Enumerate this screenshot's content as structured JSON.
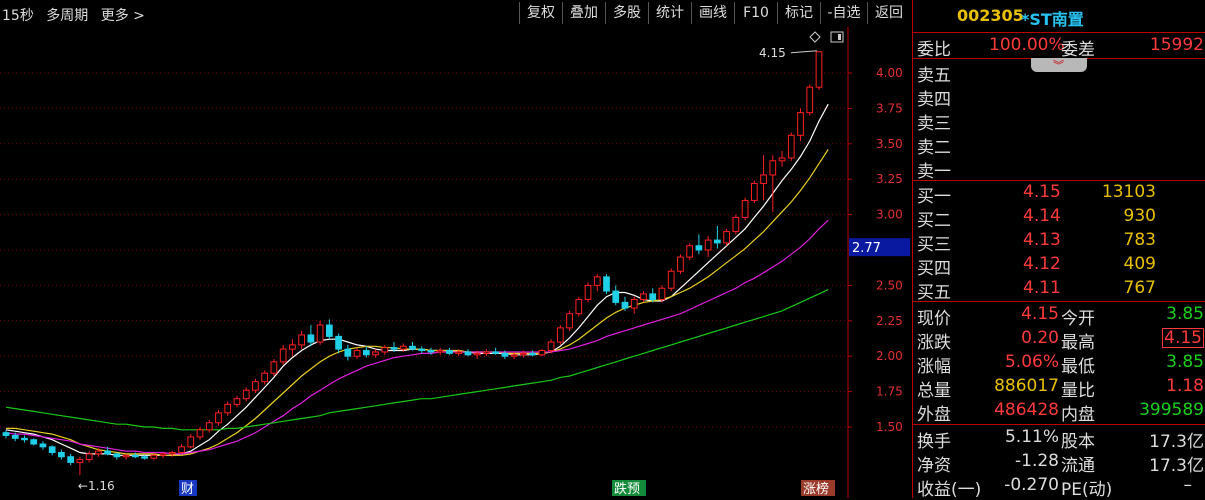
{
  "toolbar": {
    "left_items": [
      "15秒",
      "多周期",
      "更多 >"
    ],
    "buttons": [
      "复权",
      "叠加",
      "多股",
      "统计",
      "画线",
      "F10",
      "标记",
      "-自选",
      "返回"
    ]
  },
  "chart_data": {
    "type": "candlestick",
    "y_ticks": [
      "4.00",
      "3.75",
      "3.50",
      "3.25",
      "3.00",
      "2.75",
      "2.50",
      "2.25",
      "2.00",
      "1.75",
      "1.50"
    ],
    "ylim": [
      1.25,
      4.25
    ],
    "current_price_label": "2.77",
    "high_annotation": "4.15",
    "low_annotation": "←1.16",
    "bottom_markers": [
      "财",
      "跌预",
      "涨榜"
    ],
    "candles": [
      [
        1.46,
        1.48,
        1.42,
        1.44
      ],
      [
        1.44,
        1.46,
        1.4,
        1.42
      ],
      [
        1.42,
        1.44,
        1.39,
        1.41
      ],
      [
        1.41,
        1.42,
        1.37,
        1.38
      ],
      [
        1.38,
        1.4,
        1.34,
        1.36
      ],
      [
        1.36,
        1.37,
        1.3,
        1.32
      ],
      [
        1.32,
        1.34,
        1.27,
        1.29
      ],
      [
        1.29,
        1.31,
        1.23,
        1.25
      ],
      [
        1.25,
        1.29,
        1.16,
        1.27
      ],
      [
        1.27,
        1.33,
        1.25,
        1.31
      ],
      [
        1.31,
        1.35,
        1.29,
        1.33
      ],
      [
        1.33,
        1.36,
        1.3,
        1.31
      ],
      [
        1.31,
        1.32,
        1.27,
        1.29
      ],
      [
        1.29,
        1.31,
        1.27,
        1.3
      ],
      [
        1.3,
        1.32,
        1.28,
        1.29
      ],
      [
        1.29,
        1.3,
        1.27,
        1.28
      ],
      [
        1.28,
        1.31,
        1.27,
        1.3
      ],
      [
        1.3,
        1.32,
        1.28,
        1.31
      ],
      [
        1.31,
        1.33,
        1.29,
        1.32
      ],
      [
        1.32,
        1.38,
        1.31,
        1.36
      ],
      [
        1.36,
        1.45,
        1.35,
        1.43
      ],
      [
        1.43,
        1.5,
        1.41,
        1.48
      ],
      [
        1.48,
        1.55,
        1.46,
        1.53
      ],
      [
        1.53,
        1.62,
        1.51,
        1.6
      ],
      [
        1.6,
        1.68,
        1.58,
        1.66
      ],
      [
        1.66,
        1.72,
        1.64,
        1.7
      ],
      [
        1.7,
        1.78,
        1.68,
        1.76
      ],
      [
        1.76,
        1.84,
        1.74,
        1.82
      ],
      [
        1.82,
        1.9,
        1.8,
        1.88
      ],
      [
        1.88,
        1.98,
        1.86,
        1.96
      ],
      [
        1.96,
        2.08,
        1.94,
        2.05
      ],
      [
        2.05,
        2.12,
        2.0,
        2.08
      ],
      [
        2.08,
        2.18,
        2.05,
        2.15
      ],
      [
        2.15,
        2.22,
        2.07,
        2.1
      ],
      [
        2.1,
        2.25,
        2.08,
        2.22
      ],
      [
        2.22,
        2.26,
        2.12,
        2.14
      ],
      [
        2.14,
        2.16,
        2.02,
        2.05
      ],
      [
        2.05,
        2.08,
        1.97,
        2.0
      ],
      [
        2.0,
        2.06,
        1.98,
        2.04
      ],
      [
        2.04,
        2.07,
        1.99,
        2.01
      ],
      [
        2.01,
        2.05,
        1.99,
        2.03
      ],
      [
        2.03,
        2.08,
        2.01,
        2.06
      ],
      [
        2.06,
        2.1,
        2.03,
        2.05
      ],
      [
        2.05,
        2.09,
        2.03,
        2.07
      ],
      [
        2.07,
        2.1,
        2.04,
        2.05
      ],
      [
        2.05,
        2.07,
        2.02,
        2.04
      ],
      [
        2.04,
        2.06,
        2.01,
        2.03
      ],
      [
        2.03,
        2.06,
        2.01,
        2.04
      ],
      [
        2.04,
        2.06,
        2.01,
        2.02
      ],
      [
        2.02,
        2.05,
        2.0,
        2.03
      ],
      [
        2.03,
        2.05,
        2.0,
        2.01
      ],
      [
        2.01,
        2.04,
        1.98,
        2.02
      ],
      [
        2.02,
        2.05,
        2.0,
        2.03
      ],
      [
        2.03,
        2.06,
        2.01,
        2.02
      ],
      [
        2.02,
        2.04,
        1.98,
        2.0
      ],
      [
        2.0,
        2.03,
        1.98,
        2.01
      ],
      [
        2.01,
        2.04,
        1.99,
        2.02
      ],
      [
        2.02,
        2.04,
        2.0,
        2.01
      ],
      [
        2.01,
        2.05,
        2.0,
        2.04
      ],
      [
        2.04,
        2.12,
        2.02,
        2.1
      ],
      [
        2.1,
        2.22,
        2.08,
        2.2
      ],
      [
        2.2,
        2.32,
        2.18,
        2.3
      ],
      [
        2.3,
        2.42,
        2.28,
        2.4
      ],
      [
        2.4,
        2.52,
        2.38,
        2.5
      ],
      [
        2.5,
        2.58,
        2.46,
        2.56
      ],
      [
        2.56,
        2.58,
        2.44,
        2.46
      ],
      [
        2.46,
        2.5,
        2.36,
        2.38
      ],
      [
        2.38,
        2.42,
        2.32,
        2.34
      ],
      [
        2.34,
        2.42,
        2.3,
        2.4
      ],
      [
        2.4,
        2.46,
        2.38,
        2.44
      ],
      [
        2.44,
        2.48,
        2.38,
        2.4
      ],
      [
        2.4,
        2.5,
        2.38,
        2.48
      ],
      [
        2.48,
        2.62,
        2.46,
        2.6
      ],
      [
        2.6,
        2.72,
        2.58,
        2.7
      ],
      [
        2.7,
        2.8,
        2.68,
        2.78
      ],
      [
        2.78,
        2.86,
        2.72,
        2.75
      ],
      [
        2.75,
        2.85,
        2.7,
        2.82
      ],
      [
        2.82,
        2.92,
        2.76,
        2.8
      ],
      [
        2.8,
        2.9,
        2.78,
        2.88
      ],
      [
        2.88,
        3.0,
        2.86,
        2.98
      ],
      [
        2.98,
        3.12,
        2.96,
        3.1
      ],
      [
        3.1,
        3.24,
        3.08,
        3.22
      ],
      [
        3.22,
        3.42,
        3.1,
        3.28
      ],
      [
        3.28,
        3.42,
        3.02,
        3.38
      ],
      [
        3.38,
        3.45,
        3.34,
        3.4
      ],
      [
        3.4,
        3.58,
        3.38,
        3.56
      ],
      [
        3.56,
        3.75,
        3.52,
        3.72
      ],
      [
        3.72,
        3.92,
        3.7,
        3.9
      ],
      [
        3.9,
        4.15,
        3.88,
        4.15
      ]
    ],
    "ma_series": [
      {
        "color": "#ffffff",
        "values": [
          1.48,
          1.47,
          1.46,
          1.45,
          1.43,
          1.41,
          1.38,
          1.35,
          1.32,
          1.31,
          1.31,
          1.31,
          1.3,
          1.3,
          1.3,
          1.3,
          1.3,
          1.3,
          1.3,
          1.31,
          1.33,
          1.37,
          1.41,
          1.47,
          1.52,
          1.58,
          1.64,
          1.71,
          1.78,
          1.85,
          1.93,
          1.99,
          2.04,
          2.08,
          2.11,
          2.12,
          2.12,
          2.1,
          2.08,
          2.07,
          2.05,
          2.04,
          2.04,
          2.04,
          2.05,
          2.05,
          2.04,
          2.04,
          2.04,
          2.03,
          2.03,
          2.02,
          2.02,
          2.02,
          2.02,
          2.01,
          2.01,
          2.01,
          2.02,
          2.03,
          2.07,
          2.13,
          2.2,
          2.28,
          2.36,
          2.42,
          2.45,
          2.45,
          2.43,
          2.4,
          2.39,
          2.39,
          2.42,
          2.48,
          2.54,
          2.6,
          2.66,
          2.72,
          2.78,
          2.84,
          2.9,
          2.98,
          3.06,
          3.15,
          3.24,
          3.32,
          3.41,
          3.52,
          3.66,
          3.78
        ]
      },
      {
        "color": "#e8d020",
        "values": [
          1.49,
          1.49,
          1.48,
          1.47,
          1.46,
          1.45,
          1.43,
          1.41,
          1.38,
          1.36,
          1.34,
          1.33,
          1.32,
          1.31,
          1.31,
          1.31,
          1.31,
          1.3,
          1.3,
          1.3,
          1.31,
          1.33,
          1.35,
          1.38,
          1.42,
          1.46,
          1.51,
          1.56,
          1.62,
          1.68,
          1.74,
          1.8,
          1.86,
          1.91,
          1.96,
          2.0,
          2.03,
          2.05,
          2.06,
          2.07,
          2.07,
          2.06,
          2.06,
          2.05,
          2.05,
          2.05,
          2.04,
          2.04,
          2.04,
          2.04,
          2.03,
          2.03,
          2.03,
          2.03,
          2.02,
          2.02,
          2.02,
          2.02,
          2.02,
          2.03,
          2.05,
          2.08,
          2.12,
          2.17,
          2.22,
          2.27,
          2.31,
          2.34,
          2.36,
          2.38,
          2.39,
          2.4,
          2.42,
          2.45,
          2.48,
          2.52,
          2.56,
          2.61,
          2.66,
          2.71,
          2.76,
          2.82,
          2.88,
          2.95,
          3.02,
          3.09,
          3.17,
          3.26,
          3.36,
          3.46
        ]
      },
      {
        "color": "#e020e0",
        "values": [
          1.46,
          1.45,
          1.45,
          1.44,
          1.43,
          1.42,
          1.41,
          1.4,
          1.38,
          1.37,
          1.36,
          1.35,
          1.34,
          1.33,
          1.33,
          1.32,
          1.32,
          1.32,
          1.31,
          1.31,
          1.32,
          1.33,
          1.34,
          1.36,
          1.38,
          1.4,
          1.43,
          1.46,
          1.5,
          1.54,
          1.58,
          1.63,
          1.67,
          1.72,
          1.76,
          1.8,
          1.84,
          1.87,
          1.9,
          1.93,
          1.95,
          1.97,
          1.99,
          2.0,
          2.01,
          2.02,
          2.02,
          2.03,
          2.03,
          2.03,
          2.03,
          2.03,
          2.03,
          2.03,
          2.03,
          2.03,
          2.03,
          2.03,
          2.03,
          2.03,
          2.04,
          2.05,
          2.07,
          2.09,
          2.11,
          2.14,
          2.16,
          2.18,
          2.2,
          2.22,
          2.24,
          2.26,
          2.28,
          2.3,
          2.33,
          2.36,
          2.39,
          2.42,
          2.45,
          2.48,
          2.52,
          2.55,
          2.59,
          2.63,
          2.67,
          2.72,
          2.77,
          2.83,
          2.9,
          2.96
        ]
      },
      {
        "color": "#18c818",
        "values": [
          1.64,
          1.63,
          1.62,
          1.61,
          1.6,
          1.59,
          1.58,
          1.57,
          1.56,
          1.55,
          1.54,
          1.53,
          1.52,
          1.52,
          1.51,
          1.5,
          1.5,
          1.49,
          1.49,
          1.48,
          1.48,
          1.48,
          1.48,
          1.48,
          1.49,
          1.49,
          1.5,
          1.51,
          1.52,
          1.53,
          1.54,
          1.55,
          1.56,
          1.57,
          1.58,
          1.6,
          1.61,
          1.62,
          1.63,
          1.64,
          1.65,
          1.66,
          1.67,
          1.68,
          1.69,
          1.7,
          1.7,
          1.71,
          1.72,
          1.73,
          1.74,
          1.75,
          1.76,
          1.77,
          1.78,
          1.79,
          1.8,
          1.81,
          1.82,
          1.83,
          1.85,
          1.86,
          1.88,
          1.9,
          1.92,
          1.94,
          1.96,
          1.98,
          2.0,
          2.02,
          2.04,
          2.06,
          2.08,
          2.1,
          2.12,
          2.14,
          2.16,
          2.18,
          2.2,
          2.22,
          2.24,
          2.26,
          2.28,
          2.3,
          2.32,
          2.35,
          2.38,
          2.41,
          2.44,
          2.47
        ]
      }
    ]
  },
  "panel": {
    "code": "002305",
    "name": "*ST南置",
    "webi": {
      "label": "委比",
      "value": "100.00%",
      "label2": "委差",
      "value2": "15992"
    },
    "sells": [
      {
        "label": "卖五"
      },
      {
        "label": "卖四"
      },
      {
        "label": "卖三"
      },
      {
        "label": "卖二"
      },
      {
        "label": "卖一"
      }
    ],
    "buys": [
      {
        "label": "买一",
        "price": "4.15",
        "vol": "13103"
      },
      {
        "label": "买二",
        "price": "4.14",
        "vol": "930"
      },
      {
        "label": "买三",
        "price": "4.13",
        "vol": "783"
      },
      {
        "label": "买四",
        "price": "4.12",
        "vol": "409"
      },
      {
        "label": "买五",
        "price": "4.11",
        "vol": "767"
      }
    ],
    "stats": [
      {
        "l1": "现价",
        "v1": "4.15",
        "l2": "今开",
        "v2": "3.85"
      },
      {
        "l1": "涨跌",
        "v1": "0.20",
        "l2": "最高",
        "v2": "4.15"
      },
      {
        "l1": "涨幅",
        "v1": "5.06%",
        "l2": "最低",
        "v2": "3.85"
      },
      {
        "l1": "总量",
        "v1": "886017",
        "l2": "量比",
        "v2": "1.18"
      },
      {
        "l1": "外盘",
        "v1": "486428",
        "l2": "内盘",
        "v2": "399589"
      }
    ],
    "fin": [
      {
        "l1": "换手",
        "v1": "5.11%",
        "l2": "股本",
        "v2": "17.3亿"
      },
      {
        "l1": "净资",
        "v1": "-1.28",
        "l2": "流通",
        "v2": "17.3亿"
      },
      {
        "l1": "收益(一)",
        "v1": "-0.270",
        "l2": "PE(动)",
        "v2": "–"
      }
    ]
  }
}
